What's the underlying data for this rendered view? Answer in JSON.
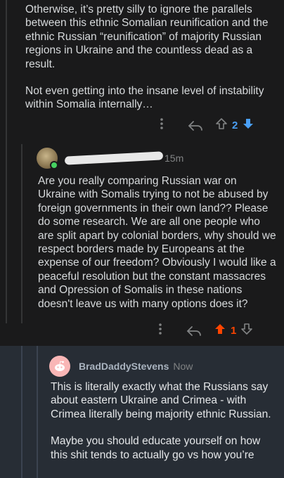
{
  "comment1": {
    "paragraphs": [
      "Otherwise, it’s pretty silly to ignore the parallels between this ethnic Somalian reunification and the ethnic Russian “reunification” of majority Russian regions in Ukraine and the countless dead as a result.",
      "Not even getting into the insane level of instability within Somalia internally…"
    ],
    "score": "2",
    "vote_state": "downvoted",
    "colors": {
      "downvote_active": "#4a9ff5"
    }
  },
  "comment2": {
    "time": "15m",
    "online": true,
    "text": "Are you really comparing Russian war on Ukraine with Somalis trying to not be abused by foreign governments in their own land?? Please do some research. We are all one people who are split apart by colonial borders, why should we respect borders made by Europeans at the expense of our freedom? Obviously I would like a peaceful resolution but the constant massacres and Opression of Somalis in these nations doesn't leave us with many options does it?",
    "score": "1",
    "vote_state": "upvoted",
    "colors": {
      "upvote_active": "#ff4500"
    }
  },
  "comment3": {
    "username": "BradDaddyStevens",
    "time": "Now",
    "paragraphs": [
      "This is literally exactly what the Russians say about eastern Ukraine and Crimea - with Crimea literally being majority ethnic Russian.",
      "Maybe you should educate yourself on how this shit tends to actually go vs how you’re"
    ],
    "highlighted": true,
    "colors": {
      "highlight_bg": "#272d35",
      "avatar_bg": "#f9b6b6"
    }
  },
  "icons": {
    "more": "more-vertical-icon",
    "reply": "reply-arrow-icon",
    "upvote": "upvote-arrow-icon",
    "downvote": "downvote-arrow-icon",
    "avatar_default": "snoo-avatar-icon"
  }
}
